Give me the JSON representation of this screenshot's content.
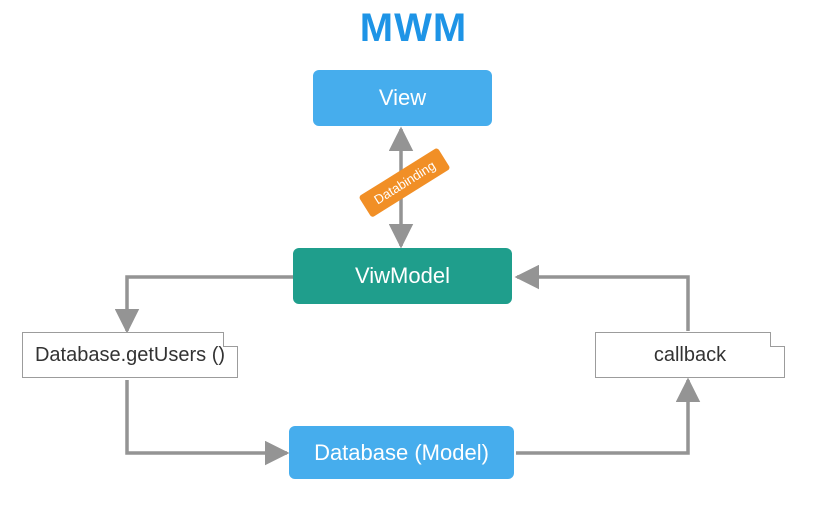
{
  "title": "MWM",
  "nodes": {
    "view": "View",
    "viewmodel": "ViwModel",
    "database": "Database (Model)",
    "getUsers": "Database.getUsers ()",
    "callback": "callback"
  },
  "tag": "Databinding",
  "colors": {
    "blue": "#46aded",
    "teal": "#1f9e8c",
    "orange": "#f18f26",
    "title": "#1e94e6",
    "arrow": "#949494",
    "noteBorder": "#9c9c9c"
  }
}
